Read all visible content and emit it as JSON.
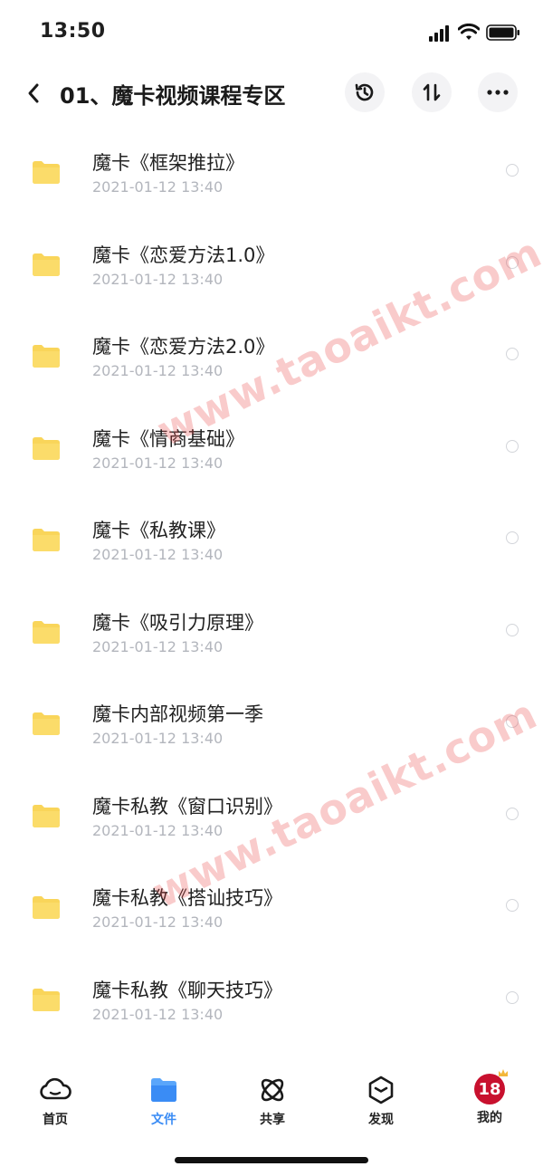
{
  "status_bar": {
    "time": "13:50"
  },
  "header": {
    "title": "01、魔卡视频课程专区"
  },
  "files": [
    {
      "name": "魔卡《框架推拉》",
      "date": "2021-01-12 13:40"
    },
    {
      "name": "魔卡《恋爱方法1.0》",
      "date": "2021-01-12 13:40"
    },
    {
      "name": "魔卡《恋爱方法2.0》",
      "date": "2021-01-12 13:40"
    },
    {
      "name": "魔卡《情商基础》",
      "date": "2021-01-12 13:40"
    },
    {
      "name": "魔卡《私教课》",
      "date": "2021-01-12 13:40"
    },
    {
      "name": "魔卡《吸引力原理》",
      "date": "2021-01-12 13:40"
    },
    {
      "name": "魔卡内部视频第一季",
      "date": "2021-01-12 13:40"
    },
    {
      "name": "魔卡私教《窗口识别》",
      "date": "2021-01-12 13:40"
    },
    {
      "name": "魔卡私教《搭讪技巧》",
      "date": "2021-01-12 13:40"
    },
    {
      "name": "魔卡私教《聊天技巧》",
      "date": "2021-01-12 13:40"
    }
  ],
  "watermark": {
    "text": "www.taoaikt.com"
  },
  "tabs": [
    {
      "label": "首页",
      "icon": "cloud-face-icon",
      "active": false
    },
    {
      "label": "文件",
      "icon": "folder-icon",
      "active": true
    },
    {
      "label": "共享",
      "icon": "atom-icon",
      "active": false
    },
    {
      "label": "发现",
      "icon": "compass-box-icon",
      "active": false
    },
    {
      "label": "我的",
      "icon": "avatar",
      "active": false,
      "avatar_text": "18"
    }
  ],
  "colors": {
    "accent": "#3a8cf5",
    "folder": "#f9d55a",
    "date": "#b3b6bd",
    "watermark": "#e84646"
  }
}
